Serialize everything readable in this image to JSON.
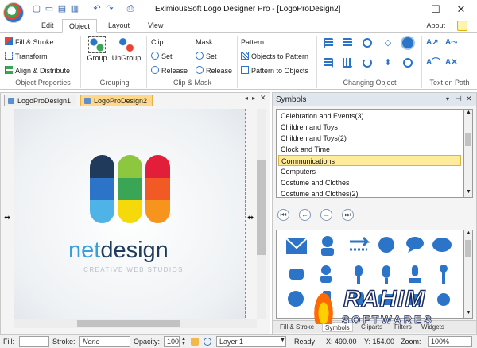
{
  "window": {
    "title": "EximiousSoft Logo Designer Pro - [LogoProDesign2]"
  },
  "quick_access": [
    "new-icon",
    "open-icon",
    "save-icon",
    "save-all-icon",
    "undo-icon",
    "redo-icon",
    "print-icon"
  ],
  "tabs": [
    {
      "label": "Edit"
    },
    {
      "label": "Object"
    },
    {
      "label": "Layout"
    },
    {
      "label": "View"
    }
  ],
  "about_label": "About",
  "ribbon": {
    "object_properties": {
      "fill_stroke": "Fill & Stroke",
      "transform": "Transform",
      "align": "Align & Distribute",
      "label": "Object Properties"
    },
    "grouping": {
      "group": "Group",
      "ungroup": "UnGroup",
      "label": "Grouping"
    },
    "clip": {
      "title": "Clip",
      "set": "Set",
      "release": "Release"
    },
    "mask": {
      "title": "Mask",
      "set": "Set",
      "release": "Release"
    },
    "clipmask_label": "Clip & Mask",
    "pattern": {
      "title": "Pattern",
      "to_pattern": "Objects to Pattern",
      "to_objects": "Pattern to Objects"
    },
    "changing_object_label": "Changing Object",
    "text_on_path_label": "Text on Path"
  },
  "doc_tabs": [
    {
      "label": "LogoProDesign1"
    },
    {
      "label": "LogoProDesign2"
    }
  ],
  "logo": {
    "brand_a": "net",
    "brand_b": "design",
    "tagline": "CREATIVE WEB STUDIOS",
    "color_a": "#3a9fd8",
    "color_b": "#1f3a5a"
  },
  "symbols": {
    "title": "Symbols",
    "categories": [
      "Celebration and Events(3)",
      "Children and Toys",
      "Children and Toys(2)",
      "Clock and Time",
      "Communications",
      "Computers",
      "Costume and Clothes",
      "Costume and Clothes(2)"
    ],
    "selected": "Communications",
    "panel_tabs": [
      "Fill & Stroke",
      "Symbols",
      "Cliparts",
      "Filters",
      "Widgets"
    ]
  },
  "status": {
    "fill_label": "Fill:",
    "stroke_label": "Stroke:",
    "stroke_value": "None",
    "opacity_label": "Opacity:",
    "opacity_value": "100",
    "layer_value": "Layer 1",
    "ready": "Ready",
    "x_value": "X: 490.00",
    "y_value": "Y: 154.00",
    "zoom_label": "Zoom:",
    "zoom_value": "100%"
  },
  "watermark": {
    "line1": "RAHIM",
    "line2": "SOFTWARES"
  },
  "colors": {
    "accent": "#2b74c8",
    "selected_tab": "#ffd989",
    "list_selection": "#ffeb9c"
  }
}
